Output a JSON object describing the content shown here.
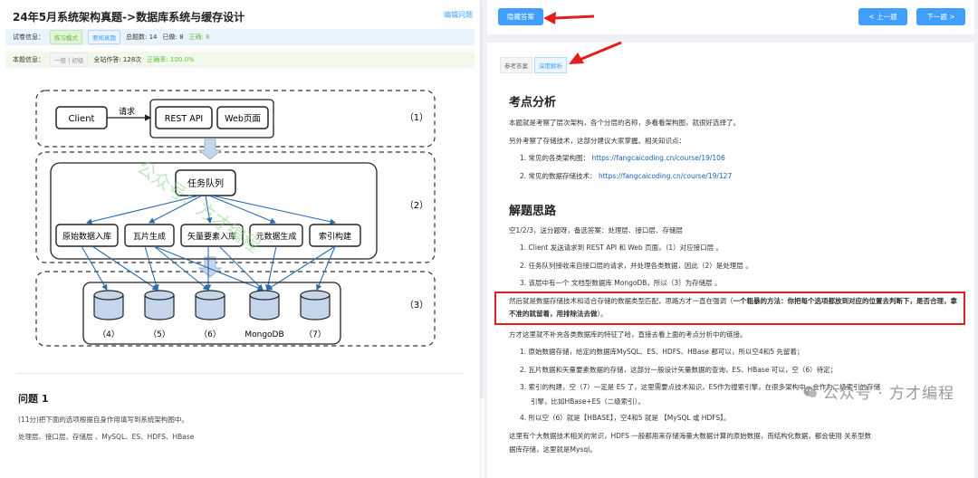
{
  "left": {
    "title": "24年5月系统架构真题->数据库系统与缓存设计",
    "edit_link": "编辑问题",
    "exam_info": {
      "label": "试卷信息：",
      "mode_tag": "练习模式",
      "view_tag": "要闻真题",
      "total": "总题数: 14",
      "done": "已做: 8",
      "correct": "正确: 8"
    },
    "question_info": {
      "label": "本题信息：",
      "tag": "一般 | 初级",
      "site_done": "全站作答: 128次",
      "rate": "正确率: 100.0%"
    },
    "diagram": {
      "client": "Client",
      "request": "请求",
      "rest_api": "REST API",
      "web_page": "Web页面",
      "queue": "任务队列",
      "modules": [
        "原始数据入库",
        "瓦片生成",
        "矢量要素入库",
        "元数据生成",
        "索引构建"
      ],
      "db_labels": [
        "（4）",
        "（5）",
        "（6）",
        "MongoDB",
        "（7）"
      ],
      "layer_labels": [
        "（1）",
        "（2）",
        "（3）"
      ],
      "watermark": "公众号：方才编程"
    },
    "question_title": "问题 1",
    "question_text": "(11分)把下面的选项根据自身作用填写到系统架构图中。",
    "question_options": "处理层、接口层、存储层 、MySQL、ES、HDFS、HBase"
  },
  "right_top": {
    "hide_answer": "隐藏答案",
    "prev": "< 上一题",
    "next": "下一题 >"
  },
  "right": {
    "tabs": [
      "参考答案",
      "深度解析"
    ],
    "h_analysis": "考点分析",
    "p1": "本题就是考察了层次架构，各个分层的名称，多看看架构图，就很好选择了。",
    "p2": "另外考察了存储技术，这部分建议大家掌握。相关知识点：",
    "link1_label": "1. 常见的各类架构图：",
    "link1": "https://fangcaicoding.cn/course/19/106",
    "link2_label": "2. 常见的数据存储技术：",
    "link2": "https://fangcaicoding.cn/course/19/127",
    "h_solution": "解题思路",
    "p3": "空1/2/3，送分题呀，备选答案：处理层、接口层、存储层",
    "s1": "1. Client 发送请求到 REST API 和 Web 页面，（1）对应接口层 。",
    "s2": "2. 任务队列接收来自接口层的请求，并处理各类数据，因此（2）是处理层 。",
    "s3": "3. 该层中有一个 文档型数据库 MongoDB，所以（3）为存储层 。",
    "hl_normal": "然后就是数据存储技术和适合存储的数据类型匹配，思路方才一直在强调（",
    "hl_bold": "一个粗暴的方法：你把每个选项都放到对应的位置去判断下，是否合理，拿不准的就留着，用排除法去做",
    "hl_end": "）。",
    "p4": "方才这里就不补充各类数据库的特征了哈，直接去看上面的考点分析中的链接。",
    "t1": "1. 原始数据存储，给定的数据库MySQL、ES、HDFS、HBase 都可以，所以空4和5 先留着；",
    "t2": "2. 瓦片数据和矢量要素数据的存储，这部分一般设计矢量数据的查询，ES、HBase 可以，空（6）待定；",
    "t3a": "3. 索引的构建，空（7）一定是 ES 了，这里需要点技术知识，ES作为搜索引擎，在很多架构中，会作为二级索引的存储",
    "t3b": "引擎，比如HBase+ES（二级索引）。",
    "t4": "4. 所以空（6）就是【HBASE】，空4和5 就是 【MySQL 或 HDFS】。",
    "p5a": "这里有个大数据技术相关的常识，HDFS 一般都用来存储海量大数据计算的原始数据，而结构化数据，都会使用 关系型数",
    "p5b": "据库存储，这里就是Mysql。",
    "watermark": "公众号 · 方才编程"
  },
  "colors": {
    "accent": "#409eff",
    "highlight": "#e02020"
  }
}
